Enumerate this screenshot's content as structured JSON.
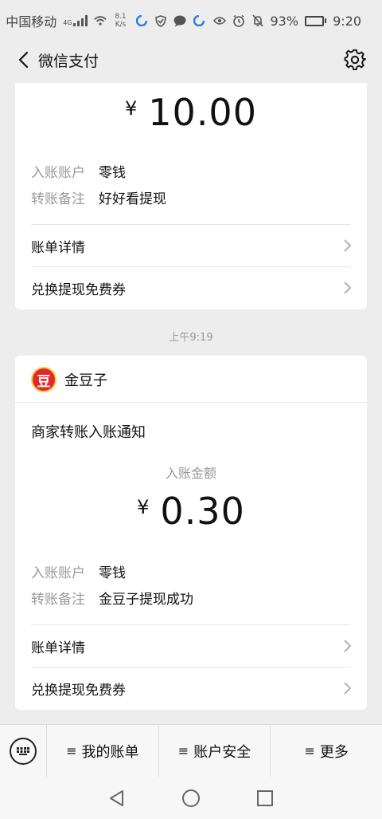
{
  "status": {
    "carrier": "中国移动",
    "network": "4G",
    "speed": "8.1 K/s",
    "battery": "93%",
    "battery_level": 0.93,
    "time": "9:20"
  },
  "nav": {
    "title": "微信支付"
  },
  "card1": {
    "currency": "¥",
    "amount": "10.00",
    "rows": [
      {
        "label": "入账账户",
        "value": "零钱"
      },
      {
        "label": "转账备注",
        "value": "好好看提现"
      }
    ],
    "links": [
      {
        "label": "账单详情"
      },
      {
        "label": "兑换提现免费券"
      }
    ]
  },
  "timestamp": "上午9:19",
  "card2": {
    "merchant_logo_text": "豆",
    "merchant": "金豆子",
    "notice_title": "商家转账入账通知",
    "amount_label": "入账金额",
    "currency": "¥",
    "amount": "0.30",
    "rows": [
      {
        "label": "入账账户",
        "value": "零钱"
      },
      {
        "label": "转账备注",
        "value": "金豆子提现成功"
      }
    ],
    "links": [
      {
        "label": "账单详情"
      },
      {
        "label": "兑换提现免费券"
      }
    ]
  },
  "tabbar": {
    "items": [
      {
        "glyph": "≡",
        "label": "我的账单"
      },
      {
        "glyph": "≡",
        "label": "账户安全"
      },
      {
        "glyph": "≡",
        "label": "更多"
      }
    ]
  }
}
